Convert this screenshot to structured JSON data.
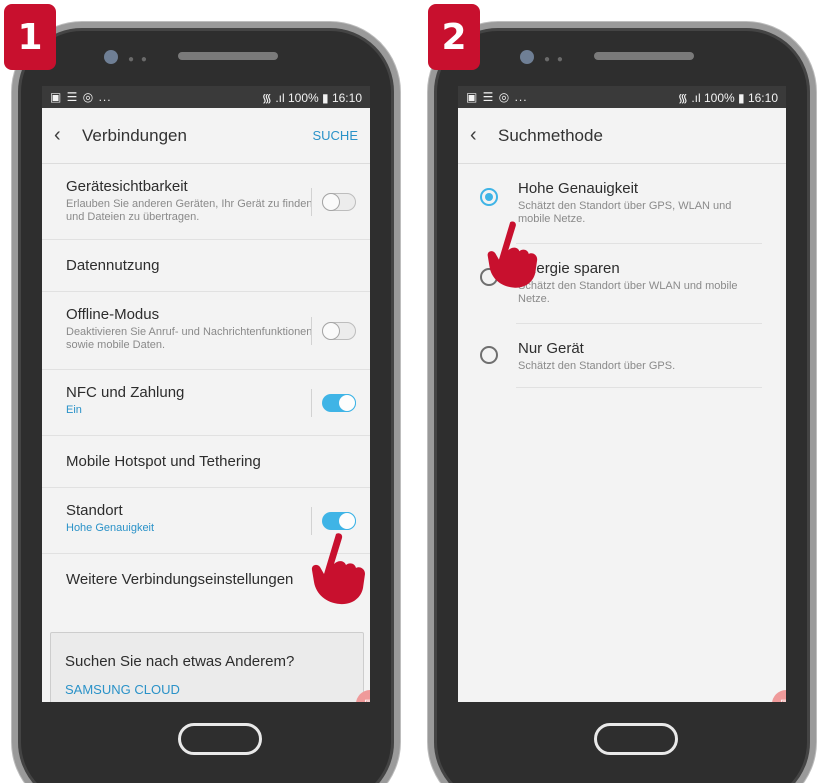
{
  "steps": [
    {
      "badge": "1",
      "status": {
        "left": "▣ ☰ ◎ ...",
        "right": "᯾ .ıl 100% ▮ 16:10"
      },
      "appbar": {
        "title": "Verbindungen",
        "search_label": "SUCHE"
      },
      "rows": [
        {
          "title": "Gerätesichtbarkeit",
          "subtitle": "Erlauben Sie anderen Geräten, Ihr Gerät zu finden und Dateien zu übertragen.",
          "toggle": "off"
        },
        {
          "title": "Datennutzung",
          "subtitle": ""
        },
        {
          "title": "Offline-Modus",
          "subtitle": "Deaktivieren Sie Anruf- und Nachrichtenfunktionen sowie mobile Daten.",
          "toggle": "off"
        },
        {
          "title": "NFC und Zahlung",
          "subtitle": "Ein",
          "toggle": "on"
        },
        {
          "title": "Mobile Hotspot und Tethering",
          "subtitle": ""
        },
        {
          "title": "Standort",
          "subtitle": "Hohe Genauigkeit",
          "toggle": "on"
        },
        {
          "title": "Weitere Verbindungseinstellungen",
          "subtitle": ""
        }
      ],
      "card": {
        "question": "Suchen Sie nach etwas Anderem?",
        "link": "SAMSUNG CLOUD"
      }
    },
    {
      "badge": "2",
      "status": {
        "left": "▣ ☰ ◎ ...",
        "right": "᯾ .ıl 100% ▮ 16:10"
      },
      "appbar": {
        "title": "Suchmethode"
      },
      "options": [
        {
          "title": "Hohe Genauigkeit",
          "subtitle": "Schätzt den Standort über GPS, WLAN und mobile Netze.",
          "selected": true
        },
        {
          "title": "Energie sparen",
          "subtitle": "Schätzt den Standort über WLAN und mobile Netze.",
          "selected": false
        },
        {
          "title": "Nur Gerät",
          "subtitle": "Schätzt den Standort über GPS.",
          "selected": false
        }
      ]
    }
  ],
  "colors": {
    "accent": "#3fb4e6",
    "link": "#2a92c8",
    "badge": "#c8102e"
  },
  "icons": {
    "back": "chevron-left-icon",
    "pointer": "hand-pointer-icon",
    "fab": "camera-icon"
  }
}
